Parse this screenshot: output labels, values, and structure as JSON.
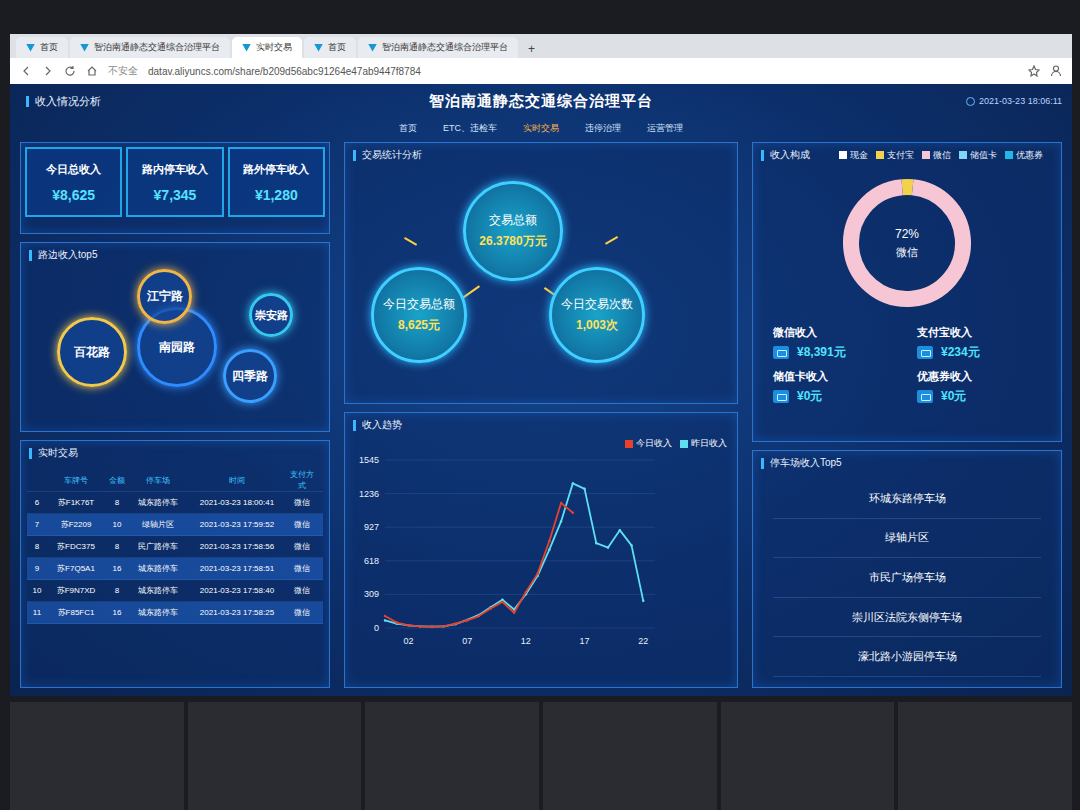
{
  "browser": {
    "tabs": [
      {
        "label": "首页",
        "selected": false
      },
      {
        "label": "智泊南通静态交通综合治理平台",
        "selected": false
      },
      {
        "label": "实时交易",
        "selected": true
      },
      {
        "label": "首页",
        "selected": false
      },
      {
        "label": "智泊南通静态交通综合治理平台",
        "selected": false
      }
    ],
    "new_tab": "+",
    "security": "不安全",
    "url": "datav.aliyuncs.com/share/b209d56abc91264e47ab9447f8784"
  },
  "header": {
    "section": "收入情况分析",
    "title": "智泊南通静态交通综合治理平台",
    "datetime": "2021-03-23 18:06:11"
  },
  "nav": [
    {
      "label": "首页",
      "selected": false
    },
    {
      "label": "ETC、违检车",
      "selected": false
    },
    {
      "label": "实时交易",
      "selected": true
    },
    {
      "label": "违停治理",
      "selected": false
    },
    {
      "label": "运营管理",
      "selected": false
    }
  ],
  "income": {
    "cards": [
      {
        "label": "今日总收入",
        "value": "¥8,625"
      },
      {
        "label": "路内停车收入",
        "value": "¥7,345"
      },
      {
        "label": "路外停车收入",
        "value": "¥1,280"
      }
    ]
  },
  "top5_roads": {
    "title": "路边收入top5",
    "bubbles": [
      {
        "label": "南园路",
        "color": "#2f8cff"
      },
      {
        "label": "百花路",
        "color": "#f2c94c"
      },
      {
        "label": "江宁路",
        "color": "#f0b548"
      },
      {
        "label": "崇安路",
        "color": "#35c8f0"
      },
      {
        "label": "四季路",
        "color": "#3aa0ff"
      }
    ]
  },
  "transactions": {
    "title": "实时交易",
    "columns": [
      "车牌号",
      "金额",
      "停车场",
      "时间",
      "支付方式"
    ],
    "rows": [
      [
        "6",
        "苏F1K76T",
        "8",
        "城东路停车",
        "2021-03-23 18:00:41",
        "微信"
      ],
      [
        "7",
        "苏F2209",
        "10",
        "绿轴片区",
        "2021-03-23 17:59:52",
        "微信"
      ],
      [
        "8",
        "苏FDC375",
        "8",
        "民广路停车",
        "2021-03-23 17:58:56",
        "微信"
      ],
      [
        "9",
        "苏F7Q5A1",
        "16",
        "城东路停车",
        "2021-03-23 17:58:51",
        "微信"
      ],
      [
        "10",
        "苏F9N7XD",
        "8",
        "城东路停车",
        "2021-03-23 17:58:40",
        "微信"
      ],
      [
        "11",
        "苏F85FC1",
        "16",
        "城东路停车",
        "2021-03-23 17:58:25",
        "微信"
      ]
    ]
  },
  "stats": {
    "title": "交易统计分析",
    "total": {
      "label": "交易总额",
      "value": "26.3780万元"
    },
    "today_amount": {
      "label": "今日交易总额",
      "value": "8,625元"
    },
    "today_count": {
      "label": "今日交易次数",
      "value": "1,003次"
    }
  },
  "trend": {
    "title": "收入趋势",
    "y_ticks": [
      "1545",
      "1236",
      "927",
      "618",
      "309",
      "0"
    ],
    "x_ticks": [
      "02",
      "07",
      "12",
      "17",
      "22"
    ],
    "series": [
      {
        "label": "今日收入",
        "color": "#e8412c",
        "values": [
          110,
          50,
          25,
          15,
          12,
          15,
          40,
          70,
          110,
          180,
          240,
          140,
          330,
          500,
          800,
          1150,
          1060
        ]
      },
      {
        "label": "昨日收入",
        "color": "#5ee0f0",
        "values": [
          70,
          40,
          25,
          15,
          12,
          15,
          35,
          75,
          120,
          190,
          260,
          170,
          310,
          480,
          720,
          980,
          1330,
          1280,
          780,
          740,
          900,
          760,
          250
        ]
      }
    ]
  },
  "composition": {
    "title": "收入构成",
    "legend": [
      {
        "label": "现金",
        "color": "#ffffff"
      },
      {
        "label": "支付宝",
        "color": "#f2d24c"
      },
      {
        "label": "微信",
        "color": "#f7c6d4"
      },
      {
        "label": "储值卡",
        "color": "#7fd6f5"
      },
      {
        "label": "优惠券",
        "color": "#22b8e6"
      }
    ],
    "donut": {
      "percent": "72",
      "unit": "%",
      "label": "微信",
      "segments": [
        {
          "color": "#f2d24c",
          "level": 0.03
        },
        {
          "color": "#f7c6d4",
          "level": 0.97
        }
      ]
    },
    "items": [
      {
        "label": "微信收入",
        "value": "¥8,391元"
      },
      {
        "label": "支付宝收入",
        "value": "¥234元"
      },
      {
        "label": "储值卡收入",
        "value": "¥0元"
      },
      {
        "label": "优惠券收入",
        "value": "¥0元"
      }
    ]
  },
  "parking_top5": {
    "title": "停车场收入Top5",
    "items": [
      "环城东路停车场",
      "绿轴片区",
      "市民广场停车场",
      "崇川区法院东侧停车场",
      "濠北路小游园停车场"
    ]
  }
}
